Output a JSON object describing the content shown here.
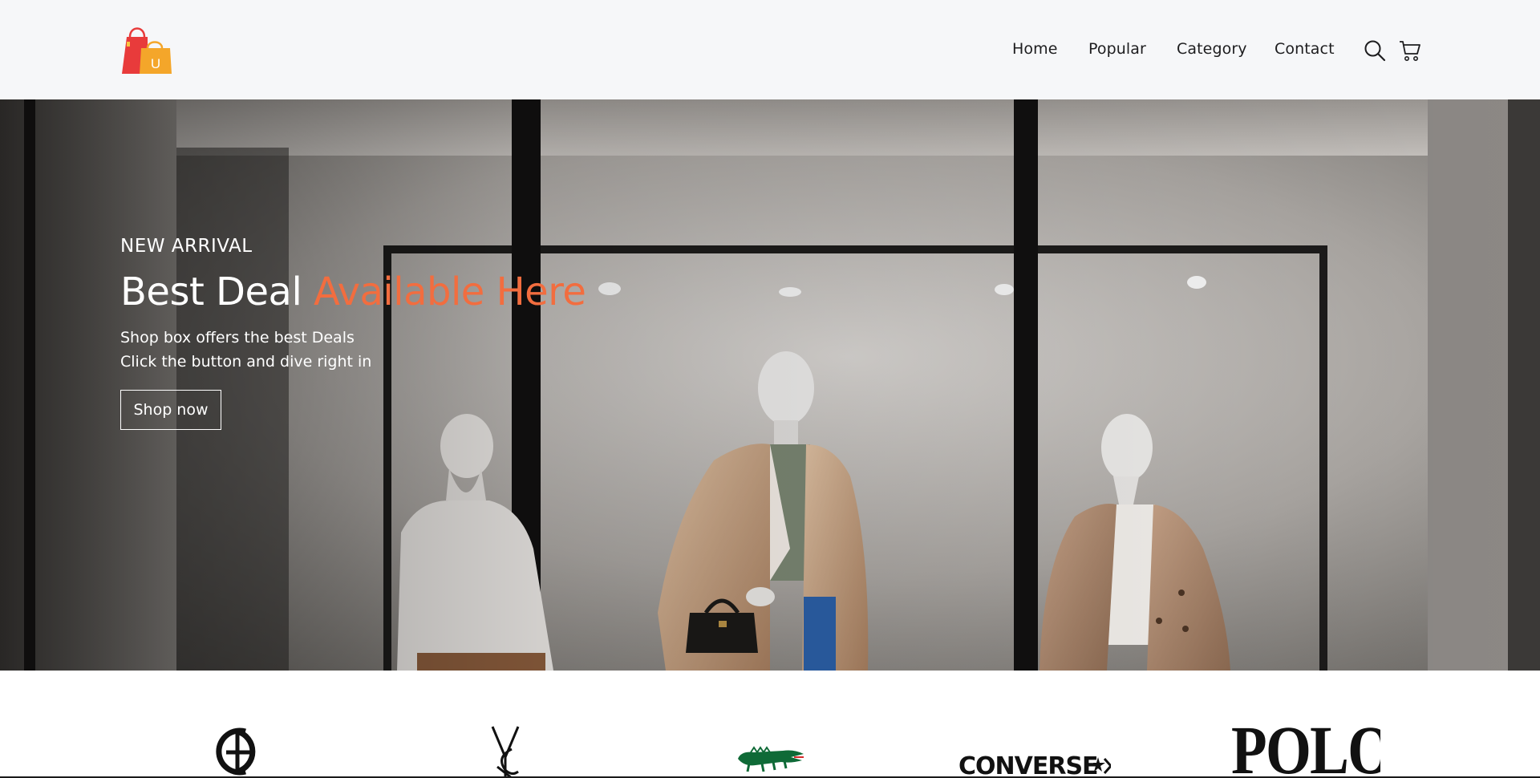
{
  "header": {
    "logo_name": "shopping-bags-logo",
    "logo_letter": "U",
    "nav": [
      {
        "label": "Home"
      },
      {
        "label": "Popular"
      },
      {
        "label": "Category"
      },
      {
        "label": "Contact"
      }
    ],
    "icons": [
      "search-icon",
      "cart-icon"
    ]
  },
  "hero": {
    "eyebrow": "NEW ARRIVAL",
    "headline_main": "Best Deal ",
    "headline_accent": "Available Here",
    "sub_line_1": "Shop box offers the best Deals",
    "sub_line_2": "Click the button and dive right in",
    "cta_label": "Shop now",
    "accent_color": "#f26d3f"
  },
  "brands": {
    "items": [
      {
        "name": "giorgio-armani-logo"
      },
      {
        "name": "ysl-logo"
      },
      {
        "name": "lacoste-logo"
      },
      {
        "name": "converse-logo",
        "text": "CONVERSE"
      },
      {
        "name": "polo-logo",
        "text": "POLO"
      }
    ]
  }
}
